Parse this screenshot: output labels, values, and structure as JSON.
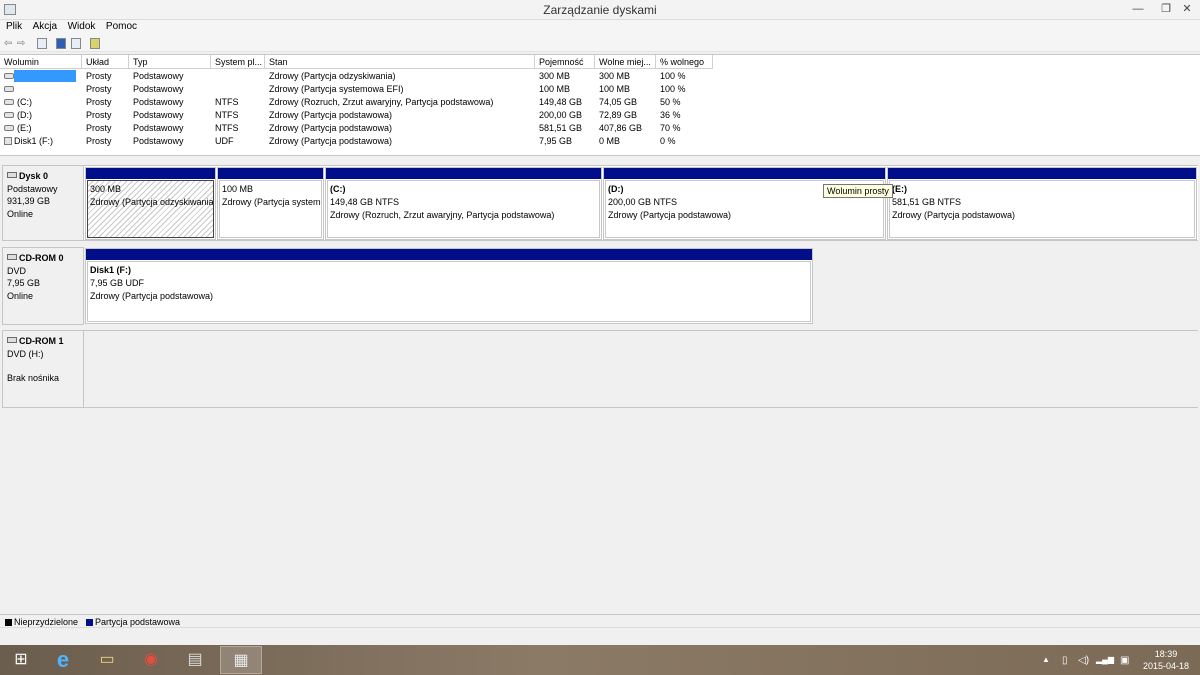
{
  "window": {
    "title": "Zarządzanie dyskami",
    "min_label": "—",
    "max_label": "❐",
    "close_label": "✕"
  },
  "menu": [
    "Plik",
    "Akcja",
    "Widok",
    "Pomoc"
  ],
  "toolbar": {
    "back": "⇦",
    "forward": "⇨"
  },
  "columns": [
    "Wolumin",
    "Układ",
    "Typ",
    "System pl...",
    "Stan",
    "Pojemność",
    "Wolne miej...",
    "% wolnego"
  ],
  "volumes": [
    {
      "name": "",
      "layout": "Prosty",
      "type": "Podstawowy",
      "fs": "",
      "status": "Zdrowy (Partycja odzyskiwania)",
      "capacity": "300 MB",
      "free": "300 MB",
      "pct": "100 %"
    },
    {
      "name": "",
      "layout": "Prosty",
      "type": "Podstawowy",
      "fs": "",
      "status": "Zdrowy (Partycja systemowa EFI)",
      "capacity": "100 MB",
      "free": "100 MB",
      "pct": "100 %"
    },
    {
      "name": "(C:)",
      "layout": "Prosty",
      "type": "Podstawowy",
      "fs": "NTFS",
      "status": "Zdrowy (Rozruch, Zrzut awaryjny, Partycja podstawowa)",
      "capacity": "149,48 GB",
      "free": "74,05 GB",
      "pct": "50 %"
    },
    {
      "name": "(D:)",
      "layout": "Prosty",
      "type": "Podstawowy",
      "fs": "NTFS",
      "status": "Zdrowy (Partycja podstawowa)",
      "capacity": "200,00 GB",
      "free": "72,89 GB",
      "pct": "36 %"
    },
    {
      "name": "(E:)",
      "layout": "Prosty",
      "type": "Podstawowy",
      "fs": "NTFS",
      "status": "Zdrowy (Partycja podstawowa)",
      "capacity": "581,51 GB",
      "free": "407,86 GB",
      "pct": "70 %"
    },
    {
      "name": "Disk1 (F:)",
      "layout": "Prosty",
      "type": "Podstawowy",
      "fs": "UDF",
      "status": "Zdrowy (Partycja podstawowa)",
      "capacity": "7,95 GB",
      "free": "0 MB",
      "pct": "0 %"
    }
  ],
  "disks": [
    {
      "name": "Dysk 0",
      "kind": "Podstawowy",
      "size": "931,39 GB",
      "state": "Online"
    },
    {
      "name": "CD-ROM 0",
      "kind": "DVD",
      "size": "7,95 GB",
      "state": "Online"
    },
    {
      "name": "CD-ROM 1",
      "kind": "DVD (H:)",
      "size": "",
      "state": "Brak nośnika"
    }
  ],
  "disk0_parts": [
    {
      "name": "",
      "size": "300 MB",
      "status": "Zdrowy (Partycja odzyskiwania)"
    },
    {
      "name": "",
      "size": "100 MB",
      "status": "Zdrowy (Partycja systemowa EFI)"
    },
    {
      "name": "(C:)",
      "size": "149,48 GB NTFS",
      "status": "Zdrowy (Rozruch, Zrzut awaryjny, Partycja podstawowa)"
    },
    {
      "name": "(D:)",
      "size": "200,00 GB NTFS",
      "status": "Zdrowy (Partycja podstawowa)"
    },
    {
      "name": "(E:)",
      "size": "581,51 GB NTFS",
      "status": "Zdrowy (Partycja podstawowa)"
    }
  ],
  "cdrom0_part": {
    "name": "Disk1  (F:)",
    "size": "7,95 GB UDF",
    "status": "Zdrowy (Partycja podstawowa)"
  },
  "tooltip": "Wolumin prosty",
  "legend": {
    "unallocated": "Nieprzydzielone",
    "primary": "Partycja podstawowa"
  },
  "colors": {
    "primary": "#000e8a",
    "unallocated": "#000000",
    "selection": "#3399ff"
  },
  "taskbar": {
    "start": "⊞",
    "ie": "e",
    "explorer": "▭",
    "chrome": "◉",
    "app1": "▤",
    "app2": "▦"
  },
  "tray": {
    "chevron": "▲",
    "power": "▯",
    "volume": "◁)",
    "network": "▂▄▆",
    "flag": "▣",
    "time": "18:39",
    "date": "2015-04-18"
  }
}
